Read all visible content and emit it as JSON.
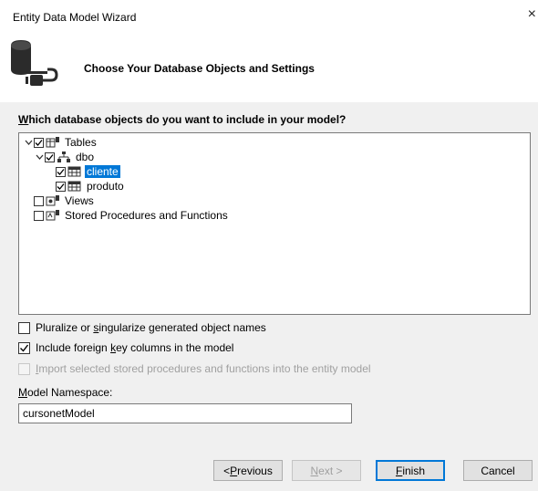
{
  "window": {
    "title": "Entity Data Model Wizard",
    "close_glyph": "×"
  },
  "header": {
    "title": "Choose Your Database Objects and Settings",
    "icon": "database-connect-icon"
  },
  "question": {
    "underlined": "W",
    "rest": "hich database objects do you want to include in your model?"
  },
  "tree": {
    "tables": {
      "label": "Tables",
      "checked": true,
      "expanded": true
    },
    "dbo": {
      "label": "dbo",
      "checked": true,
      "expanded": true
    },
    "cliente": {
      "label": "cliente",
      "checked": true,
      "selected": true
    },
    "produto": {
      "label": "produto",
      "checked": true
    },
    "views": {
      "label": "Views",
      "checked": false
    },
    "procs": {
      "label": "Stored Procedures and Functions",
      "checked": false
    }
  },
  "options": {
    "pluralize": {
      "pre": "Pluralize or ",
      "u": "s",
      "post": "ingularize generated object names",
      "checked": false
    },
    "foreign": {
      "pre": "Include foreign ",
      "u": "k",
      "post": "ey columns in the model",
      "checked": true
    },
    "import": {
      "pre": "",
      "u": "I",
      "post": "mport selected stored procedures and functions into the entity model",
      "checked": false,
      "disabled": true
    }
  },
  "namespace": {
    "label_u": "M",
    "label_rest": "odel Namespace:",
    "value": "cursonetModel"
  },
  "buttons": {
    "previous": {
      "pre": "< ",
      "u": "P",
      "post": "revious"
    },
    "next": {
      "pre": "",
      "u": "N",
      "post": "ext >"
    },
    "finish": {
      "pre": "",
      "u": "F",
      "post": "inish"
    },
    "cancel": {
      "label": "Cancel"
    }
  },
  "colors": {
    "accent": "#0078d7",
    "dialog_bg": "#f0f0f0",
    "header_bg": "#ffffff"
  }
}
